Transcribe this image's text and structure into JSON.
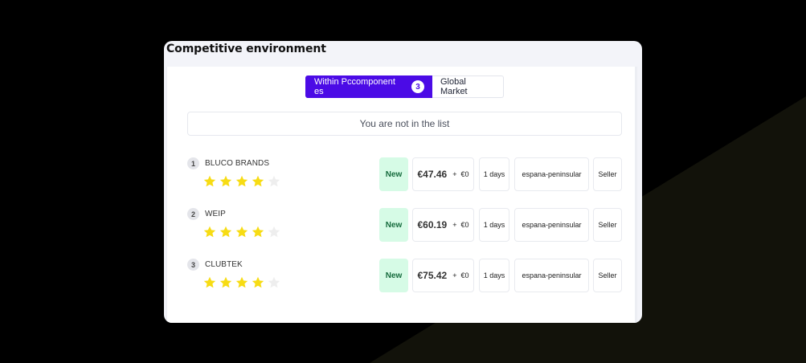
{
  "card": {
    "title": "Competitive environment"
  },
  "tabs": [
    {
      "label": "Within Pccomponent es",
      "count": "3",
      "active": true
    },
    {
      "label": "Global Market",
      "active": false
    }
  ],
  "notice": "You are not in the list",
  "competitors": [
    {
      "rank": "1",
      "name": "BLUCO BRANDS",
      "rating": 4,
      "max_rating": 5,
      "condition": "New",
      "price": "€47.46",
      "plus": "+",
      "shipping": "€0",
      "delivery": "1 days",
      "region": "espana-peninsular",
      "seller_type": "Seller"
    },
    {
      "rank": "2",
      "name": "WEIP",
      "rating": 4,
      "max_rating": 5,
      "condition": "New",
      "price": "€60.19",
      "plus": "+",
      "shipping": "€0",
      "delivery": "1 days",
      "region": "espana-peninsular",
      "seller_type": "Seller"
    },
    {
      "rank": "3",
      "name": "CLUBTEK",
      "rating": 4,
      "max_rating": 5,
      "condition": "New",
      "price": "€75.42",
      "plus": "+",
      "shipping": "€0",
      "delivery": "1 days",
      "region": "espana-peninsular",
      "seller_type": "Seller"
    }
  ],
  "colors": {
    "accent": "#4b0be6",
    "star_filled": "#f7dc14",
    "star_empty": "#eeeeee",
    "condition_bg": "#d6fbe6",
    "background": "#000000",
    "background_shape": "#12120a"
  }
}
